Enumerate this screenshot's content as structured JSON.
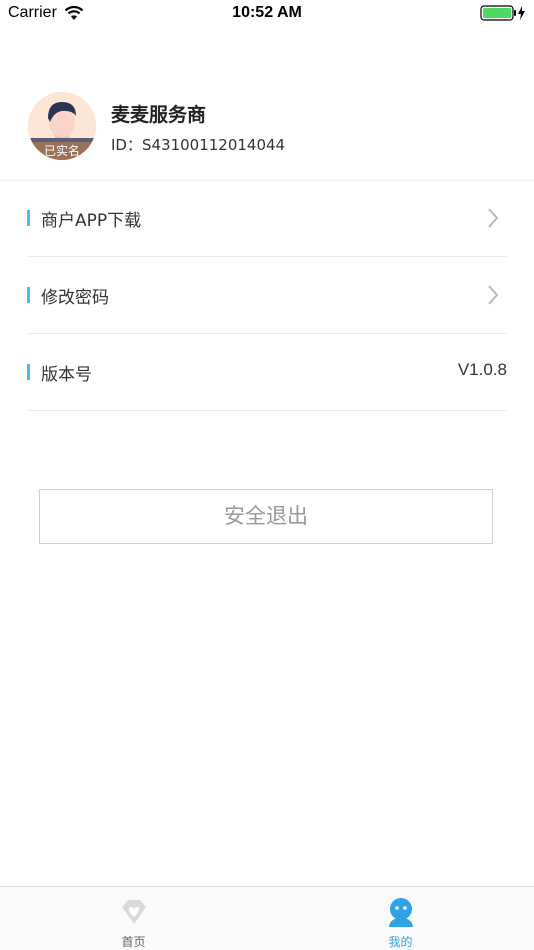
{
  "status_bar": {
    "carrier": "Carrier",
    "time": "10:52 AM"
  },
  "profile": {
    "name": "麦麦服务商",
    "id_text": "ID：S43100112014044",
    "verified_badge": "已实名",
    "avatar_icon": "user-avatar"
  },
  "menu": {
    "items": [
      {
        "label": "商户APP下载",
        "icon": "chevron-right-icon"
      },
      {
        "label": "修改密码",
        "icon": "chevron-right-icon"
      },
      {
        "label": "版本号",
        "value": "V1.0.8"
      }
    ]
  },
  "logout_label": "安全退出",
  "tabbar": {
    "tabs": [
      {
        "label": "首页",
        "icon": "home-heart-icon",
        "active": false
      },
      {
        "label": "我的",
        "icon": "profile-icon",
        "active": true
      }
    ],
    "active_color": "#2fa3e6",
    "inactive_color": "#666666"
  },
  "colors": {
    "accent": "#4fb8f0",
    "battery": "#4cd964"
  }
}
